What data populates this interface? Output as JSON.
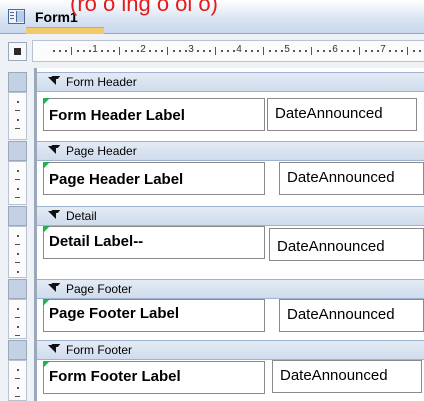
{
  "window": {
    "top_text": "(ro o ing o ol o)",
    "title": "Form1"
  },
  "ruler": {
    "numbers": [
      "1",
      "2",
      "3",
      "4",
      "5",
      "6",
      "7"
    ]
  },
  "sections": [
    {
      "id": "form-header",
      "title": "Form Header",
      "label": "Form Header  Label",
      "field": "DateAnnounced"
    },
    {
      "id": "page-header",
      "title": "Page Header",
      "label": "Page Header Label",
      "field": "DateAnnounced"
    },
    {
      "id": "detail",
      "title": "Detail",
      "label": "Detail Label--",
      "field": "DateAnnounced"
    },
    {
      "id": "page-footer",
      "title": "Page Footer",
      "label": "Page Footer Label",
      "field": "DateAnnounced"
    },
    {
      "id": "form-footer",
      "title": "Form Footer",
      "label": "Form Footer  Label",
      "field": "DateAnnounced"
    }
  ],
  "colors": {
    "section_bar": "#cfdbec",
    "label_marker": "#22b14c",
    "title_accent": "#f4c96a"
  }
}
